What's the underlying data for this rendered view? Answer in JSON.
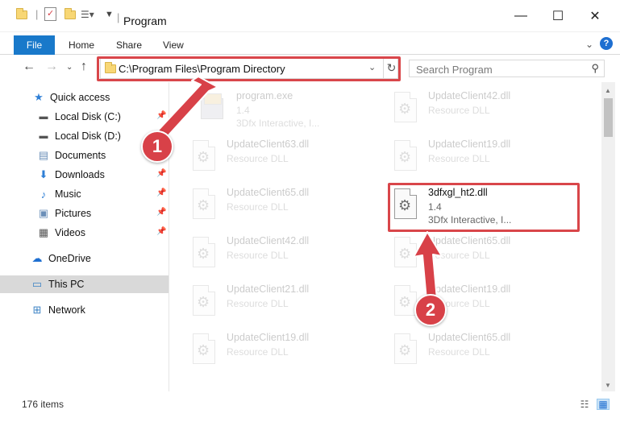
{
  "window": {
    "title": "Program",
    "minimize_glyph": "—",
    "maximize_glyph": "☐",
    "close_glyph": "✕"
  },
  "ribbon": {
    "tabs": [
      "File",
      "Home",
      "Share",
      "View"
    ],
    "help_glyph": "?"
  },
  "address_bar": {
    "path": "C:\\Program Files\\Program Directory"
  },
  "search": {
    "placeholder": "Search Program"
  },
  "nav_pane": {
    "items": [
      {
        "label": "Quick access",
        "icon": "star-icon",
        "glyph": "★",
        "color": "#2f7fd6"
      },
      {
        "label": "Local Disk (C:)",
        "icon": "drive-icon",
        "glyph": "▬",
        "color": "#555555"
      },
      {
        "label": "Local Disk (D:)",
        "icon": "drive-icon",
        "glyph": "▬",
        "color": "#555555"
      },
      {
        "label": "Documents",
        "icon": "documents-icon",
        "glyph": "▤",
        "color": "#6b8fb8"
      },
      {
        "label": "Downloads",
        "icon": "download-icon",
        "glyph": "⬇",
        "color": "#2f7fd6"
      },
      {
        "label": "Music",
        "icon": "music-icon",
        "glyph": "♪",
        "color": "#2f7fd6"
      },
      {
        "label": "Pictures",
        "icon": "pictures-icon",
        "glyph": "▣",
        "color": "#6b8fb8"
      },
      {
        "label": "Videos",
        "icon": "videos-icon",
        "glyph": "▦",
        "color": "#555555"
      },
      {
        "label": "OneDrive",
        "icon": "cloud-icon",
        "glyph": "☁",
        "color": "#1e6fd1"
      },
      {
        "label": "This PC",
        "icon": "computer-icon",
        "glyph": "▭",
        "color": "#3b82c4"
      },
      {
        "label": "Network",
        "icon": "network-icon",
        "glyph": "⊞",
        "color": "#3b82c4"
      }
    ]
  },
  "files": [
    {
      "name": "program.exe",
      "line2": "1.4",
      "line3": "3Dfx Interactive, I..."
    },
    {
      "name": "UpdateClient42.dll",
      "line2": "Resource DLL",
      "line3": ""
    },
    {
      "name": "UpdateClient63.dll",
      "line2": "Resource DLL",
      "line3": ""
    },
    {
      "name": "UpdateClient19.dll",
      "line2": "Resource DLL",
      "line3": ""
    },
    {
      "name": "UpdateClient65.dll",
      "line2": "Resource DLL",
      "line3": ""
    },
    {
      "name": "3dfxgl_ht2.dll",
      "line2": "1.4",
      "line3": "3Dfx Interactive, I..."
    },
    {
      "name": "UpdateClient42.dll",
      "line2": "Resource DLL",
      "line3": ""
    },
    {
      "name": "UpdateClient65.dll",
      "line2": "Resource DLL",
      "line3": ""
    },
    {
      "name": "UpdateClient21.dll",
      "line2": "Resource DLL",
      "line3": ""
    },
    {
      "name": "UpdateClient19.dll",
      "line2": "Resource DLL",
      "line3": ""
    },
    {
      "name": "UpdateClient19.dll",
      "line2": "Resource DLL",
      "line3": ""
    },
    {
      "name": "UpdateClient65.dll",
      "line2": "Resource DLL",
      "line3": ""
    }
  ],
  "status": {
    "item_count": "176 items"
  },
  "annotations": {
    "step1": "1",
    "step2": "2",
    "color": "#d84148"
  }
}
